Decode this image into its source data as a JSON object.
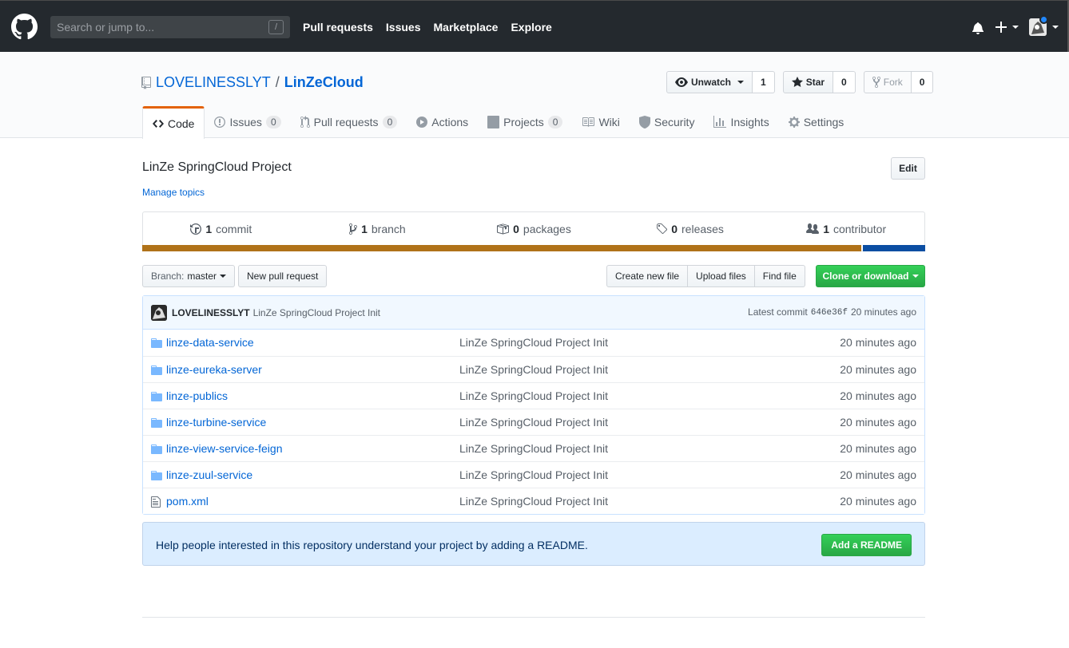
{
  "header": {
    "search_placeholder": "Search or jump to...",
    "slash_key": "/",
    "nav": [
      "Pull requests",
      "Issues",
      "Marketplace",
      "Explore"
    ],
    "plus": "+"
  },
  "repo": {
    "owner": "LOVELINESSLYT",
    "separator": "/",
    "name": "LinZeCloud",
    "actions": {
      "watch": {
        "label": "Unwatch",
        "count": "1"
      },
      "star": {
        "label": "Star",
        "count": "0"
      },
      "fork": {
        "label": "Fork",
        "count": "0"
      }
    },
    "tabs": [
      {
        "label": "Code",
        "icon": "code-icon"
      },
      {
        "label": "Issues",
        "count": "0",
        "icon": "issue-icon"
      },
      {
        "label": "Pull requests",
        "count": "0",
        "icon": "pull-request-icon"
      },
      {
        "label": "Actions",
        "icon": "play-icon"
      },
      {
        "label": "Projects",
        "count": "0",
        "icon": "project-icon"
      },
      {
        "label": "Wiki",
        "icon": "book-icon"
      },
      {
        "label": "Security",
        "icon": "shield-icon"
      },
      {
        "label": "Insights",
        "icon": "graph-icon"
      },
      {
        "label": "Settings",
        "icon": "gear-icon"
      }
    ],
    "description": "LinZe SpringCloud Project",
    "manage_topics": "Manage topics",
    "edit_label": "Edit"
  },
  "summary": {
    "commits": {
      "num": "1",
      "label": "commit"
    },
    "branches": {
      "num": "1",
      "label": "branch"
    },
    "packages": {
      "num": "0",
      "label": "packages"
    },
    "releases": {
      "num": "0",
      "label": "releases"
    },
    "contributors": {
      "num": "1",
      "label": "contributor"
    },
    "languages": [
      {
        "color": "#b07219",
        "percent": 92
      },
      {
        "color": "#0b4ea2",
        "percent": 8
      }
    ]
  },
  "filenav": {
    "branch_prefix": "Branch:",
    "branch_name": "master",
    "new_pr": "New pull request",
    "create_file": "Create new file",
    "upload_files": "Upload files",
    "find_file": "Find file",
    "clone": "Clone or download"
  },
  "commit": {
    "author": "LOVELINESSLYT",
    "message": "LinZe SpringCloud Project Init",
    "latest_label": "Latest commit",
    "sha": "646e36f",
    "age": "20 minutes ago"
  },
  "files": [
    {
      "name": "linze-data-service",
      "type": "dir",
      "message": "LinZe SpringCloud Project Init",
      "age": "20 minutes ago"
    },
    {
      "name": "linze-eureka-server",
      "type": "dir",
      "message": "LinZe SpringCloud Project Init",
      "age": "20 minutes ago"
    },
    {
      "name": "linze-publics",
      "type": "dir",
      "message": "LinZe SpringCloud Project Init",
      "age": "20 minutes ago"
    },
    {
      "name": "linze-turbine-service",
      "type": "dir",
      "message": "LinZe SpringCloud Project Init",
      "age": "20 minutes ago"
    },
    {
      "name": "linze-view-service-feign",
      "type": "dir",
      "message": "LinZe SpringCloud Project Init",
      "age": "20 minutes ago"
    },
    {
      "name": "linze-zuul-service",
      "type": "dir",
      "message": "LinZe SpringCloud Project Init",
      "age": "20 minutes ago"
    },
    {
      "name": "pom.xml",
      "type": "file",
      "message": "LinZe SpringCloud Project Init",
      "age": "20 minutes ago"
    }
  ],
  "readme": {
    "text": "Help people interested in this repository understand your project by adding a README.",
    "button": "Add a README"
  }
}
